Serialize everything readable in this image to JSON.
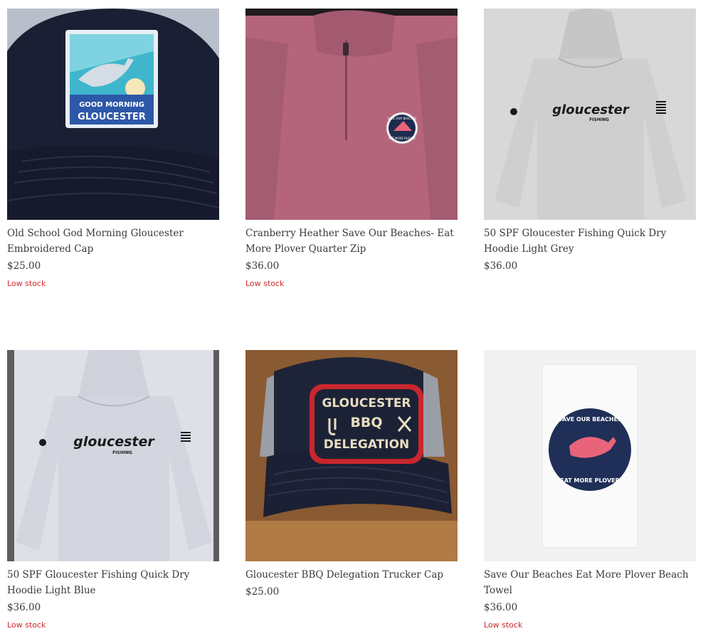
{
  "colors": {
    "low_stock": "#d0262c",
    "text": "#3a3a3a"
  },
  "products": [
    {
      "title": "Old School God Morning Gloucester Embroidered Cap",
      "price": "$25.00",
      "stock": "Low stock",
      "image": {
        "patch_line1": "GOOD MORNING",
        "patch_line2": "GLOUCESTER"
      }
    },
    {
      "title": "Cranberry Heather Save Our Beaches- Eat More Plover Quarter Zip",
      "price": "$36.00",
      "stock": "Low stock",
      "image": {
        "patch_line1": "SAVE OUR BEACHES",
        "patch_line2": "EAT MORE PLOVER"
      }
    },
    {
      "title": "50 SPF Gloucester Fishing Quick Dry Hoodie Light Grey",
      "price": "$36.00",
      "stock": "",
      "image": {
        "logo_line1": "gloucester",
        "logo_line2": "FISHING"
      }
    },
    {
      "title": "50 SPF Gloucester Fishing Quick Dry Hoodie Light Blue",
      "price": "$36.00",
      "stock": "Low stock",
      "image": {
        "logo_line1": "gloucester",
        "logo_line2": "FISHING"
      }
    },
    {
      "title": "Gloucester BBQ Delegation Trucker Cap",
      "price": "$25.00",
      "stock": "",
      "image": {
        "patch_line1": "GLOUCESTER",
        "patch_line2": "BBQ",
        "patch_line3": "DELEGATION"
      }
    },
    {
      "title": "Save Our Beaches Eat More Plover Beach Towel",
      "price": "$36.00",
      "stock": "Low stock",
      "image": {
        "patch_line1": "SAVE OUR BEACHES",
        "patch_line2": "EAT MORE PLOVER"
      }
    }
  ]
}
